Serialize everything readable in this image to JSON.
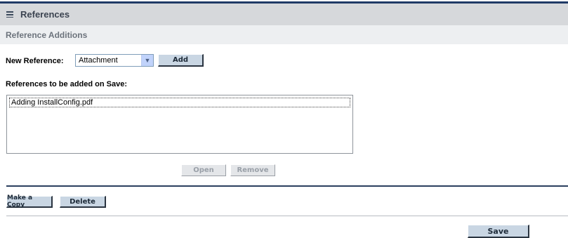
{
  "section": {
    "title": "References",
    "collapse_icon": "minus-box-icon"
  },
  "subsection": {
    "title": "Reference Additions"
  },
  "new_reference": {
    "label": "New Reference:",
    "selected": "Attachment",
    "add_label": "Add"
  },
  "pending": {
    "label": "References to be added on Save:",
    "items": [
      "Adding  InstallConfig.pdf"
    ],
    "open_label": "Open",
    "remove_label": "Remove"
  },
  "actions": {
    "copy_label": "Make a Copy",
    "delete_label": "Delete",
    "save_label": "Save"
  },
  "colors": {
    "header_rule": "#1f3a66",
    "header_bg": "#d6d8db",
    "button_bg": "#c9d6e3"
  }
}
